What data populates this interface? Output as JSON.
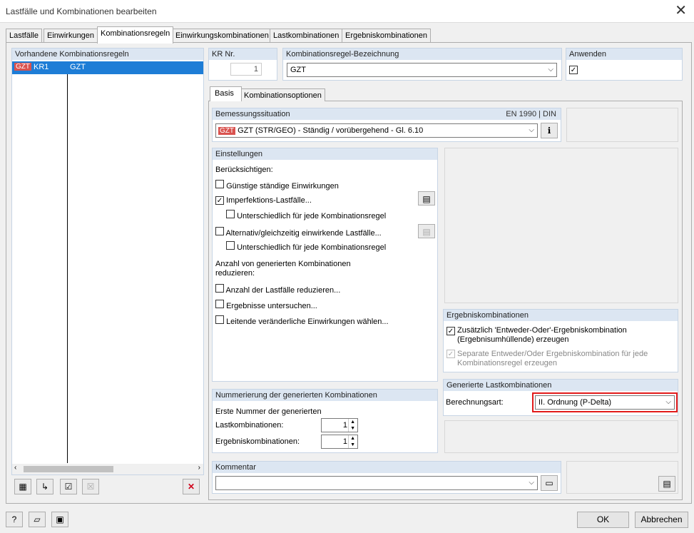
{
  "window": {
    "title": "Lastfälle und Kombinationen bearbeiten",
    "close_glyph": "✕"
  },
  "tabs": [
    "Lastfälle",
    "Einwirkungen",
    "Kombinationsregeln",
    "Einwirkungskombinationen",
    "Lastkombinationen",
    "Ergebniskombinationen"
  ],
  "rules_list": {
    "header": "Vorhandene Kombinationsregeln",
    "rows": [
      {
        "badge": "GZT",
        "id": "KR1",
        "name": "GZT"
      }
    ]
  },
  "kr_nr": {
    "label": "KR Nr.",
    "value": "1"
  },
  "bezeichnung": {
    "label": "Kombinationsregel-Bezeichnung",
    "value": "GZT"
  },
  "anwenden": {
    "label": "Anwenden",
    "checked": "✓"
  },
  "inner_tabs": [
    "Basis",
    "Kombinationsoptionen"
  ],
  "bemessung": {
    "label": "Bemessungssituation",
    "norm": "EN 1990 | DIN",
    "badge": "GZT",
    "value": "GZT (STR/GEO) - Ständig / vorübergehend - Gl. 6.10"
  },
  "einstellungen": {
    "label": "Einstellungen",
    "consider": "Berücksichtigen:",
    "opt1": "Günstige ständige Einwirkungen",
    "opt2": "Imperfektions-Lastfälle...",
    "opt2a": "Unterschiedlich für jede Kombinationsregel",
    "opt3": "Alternativ/gleichzeitig einwirkende Lastfälle...",
    "opt3a": "Unterschiedlich für jede Kombinationsregel",
    "reduce_label_1": "Anzahl von generierten Kombinationen",
    "reduce_label_2": "reduzieren:",
    "opt4": "Anzahl der Lastfälle reduzieren...",
    "opt5": "Ergebnisse untersuchen...",
    "opt6": "Leitende veränderliche Einwirkungen wählen..."
  },
  "ergebnis": {
    "label": "Ergebniskombinationen",
    "opt1_1": "Zusätzlich 'Entweder-Oder'-Ergebniskombination",
    "opt1_2": "(Ergebnisumhüllende) erzeugen",
    "opt2_1": "Separate Entweder/Oder Ergebniskombination für jede",
    "opt2_2": "Kombinationsregel  erzeugen"
  },
  "nummerierung": {
    "label": "Nummerierung der generierten Kombinationen",
    "first": "Erste Nummer der generierten",
    "lk_label": "Lastkombinationen:",
    "lk_value": "1",
    "ek_label": "Ergebniskombinationen:",
    "ek_value": "1"
  },
  "generiert": {
    "label": "Generierte Lastkombinationen",
    "berechnung_label": "Berechnungsart:",
    "berechnung_value": "II. Ordnung (P-Delta)",
    "highlight_color": "#e21b1b"
  },
  "kommentar": {
    "label": "Kommentar",
    "value": ""
  },
  "footer": {
    "ok": "OK",
    "cancel": "Abbrechen"
  },
  "colors": {
    "header_bg": "#dce6f2",
    "selection": "#1e7dd6"
  }
}
